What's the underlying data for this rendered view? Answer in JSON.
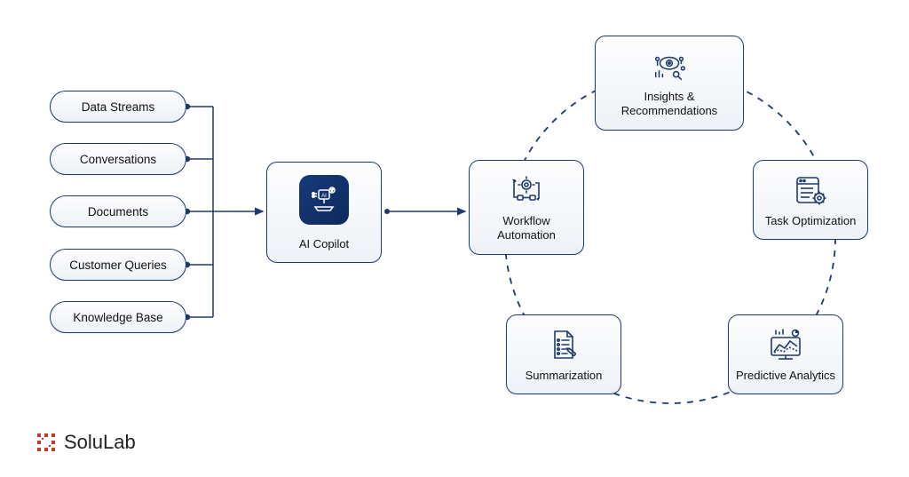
{
  "inputs": [
    {
      "label": "Data Streams"
    },
    {
      "label": "Conversations"
    },
    {
      "label": "Documents"
    },
    {
      "label": "Customer Queries"
    },
    {
      "label": "Knowledge Base"
    }
  ],
  "center": {
    "label": "AI Copilot"
  },
  "outputs": {
    "workflow": {
      "label": "Workflow Automation"
    },
    "insights": {
      "label": "Insights & Recommendations"
    },
    "task": {
      "label": "Task Optimization"
    },
    "predictive": {
      "label": "Predictive Analytics"
    },
    "summarization": {
      "label": "Summarization"
    }
  },
  "brand": {
    "name": "SoluLab"
  },
  "colors": {
    "line": "#1d3a6e",
    "dash": "#1d3a6e"
  }
}
